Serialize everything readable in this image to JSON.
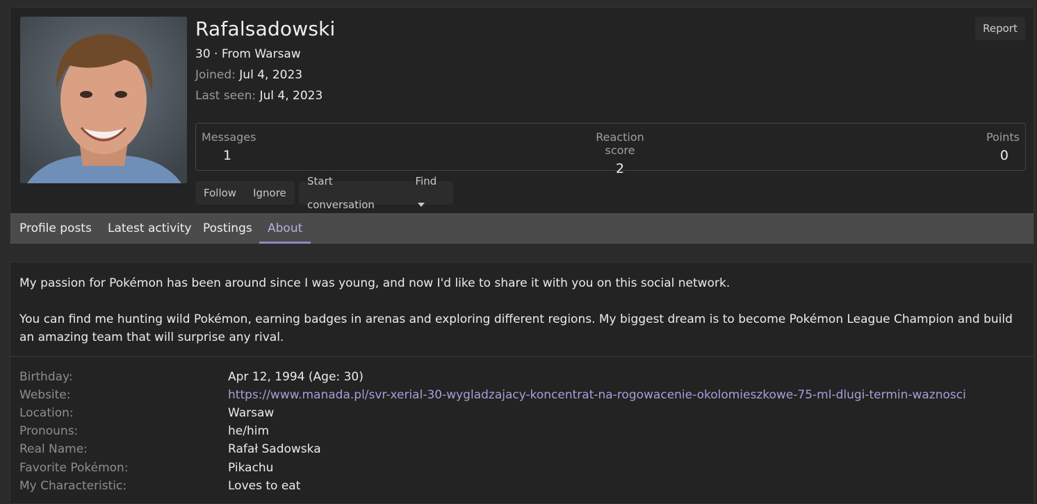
{
  "profile": {
    "username": "Rafalsadowski",
    "age_location": "30 · From Warsaw",
    "joined_label": "Joined:",
    "joined_value": "Jul 4, 2023",
    "last_seen_label": "Last seen:",
    "last_seen_value": "Jul 4, 2023",
    "report_label": "Report"
  },
  "stats": {
    "messages_label": "Messages",
    "messages_value": "1",
    "reaction_label": "Reaction score",
    "reaction_value": "2",
    "points_label": "Points",
    "points_value": "0"
  },
  "actions": {
    "follow": "Follow",
    "ignore": "Ignore",
    "start_conversation": "Start conversation",
    "find": "Find"
  },
  "tabs": [
    {
      "label": "Profile posts"
    },
    {
      "label": "Latest activity"
    },
    {
      "label": "Postings"
    },
    {
      "label": "About"
    }
  ],
  "about": {
    "bio_1": "My passion for Pokémon has been around since I was young, and now I'd like to share it with you on this social network.",
    "bio_2": "You can find me hunting wild Pokémon, earning badges in arenas and exploring different regions. My biggest dream is to become Pokémon League Champion and build an amazing team that will surprise any rival.",
    "fields": [
      {
        "label": "Birthday:",
        "value": "Apr 12, 1994 (Age: 30)"
      },
      {
        "label": "Website:",
        "value": "https://www.manada.pl/svr-xerial-30-wygladzajacy-koncentrat-na-rogowacenie-okolomieszkowe-75-ml-dlugi-termin-waznosci"
      },
      {
        "label": "Location:",
        "value": "Warsaw"
      },
      {
        "label": "Pronouns:",
        "value": "he/him"
      },
      {
        "label": "Real Name:",
        "value": "Rafał Sadowska"
      },
      {
        "label": "Favorite Pokémon:",
        "value": "Pikachu"
      },
      {
        "label": "My Characteristic:",
        "value": "Loves to eat"
      }
    ]
  },
  "colors": {
    "accent": "#8f86c6",
    "link": "#a89fd8",
    "panel": "#232323",
    "tab_bar": "#4b4b4b"
  }
}
